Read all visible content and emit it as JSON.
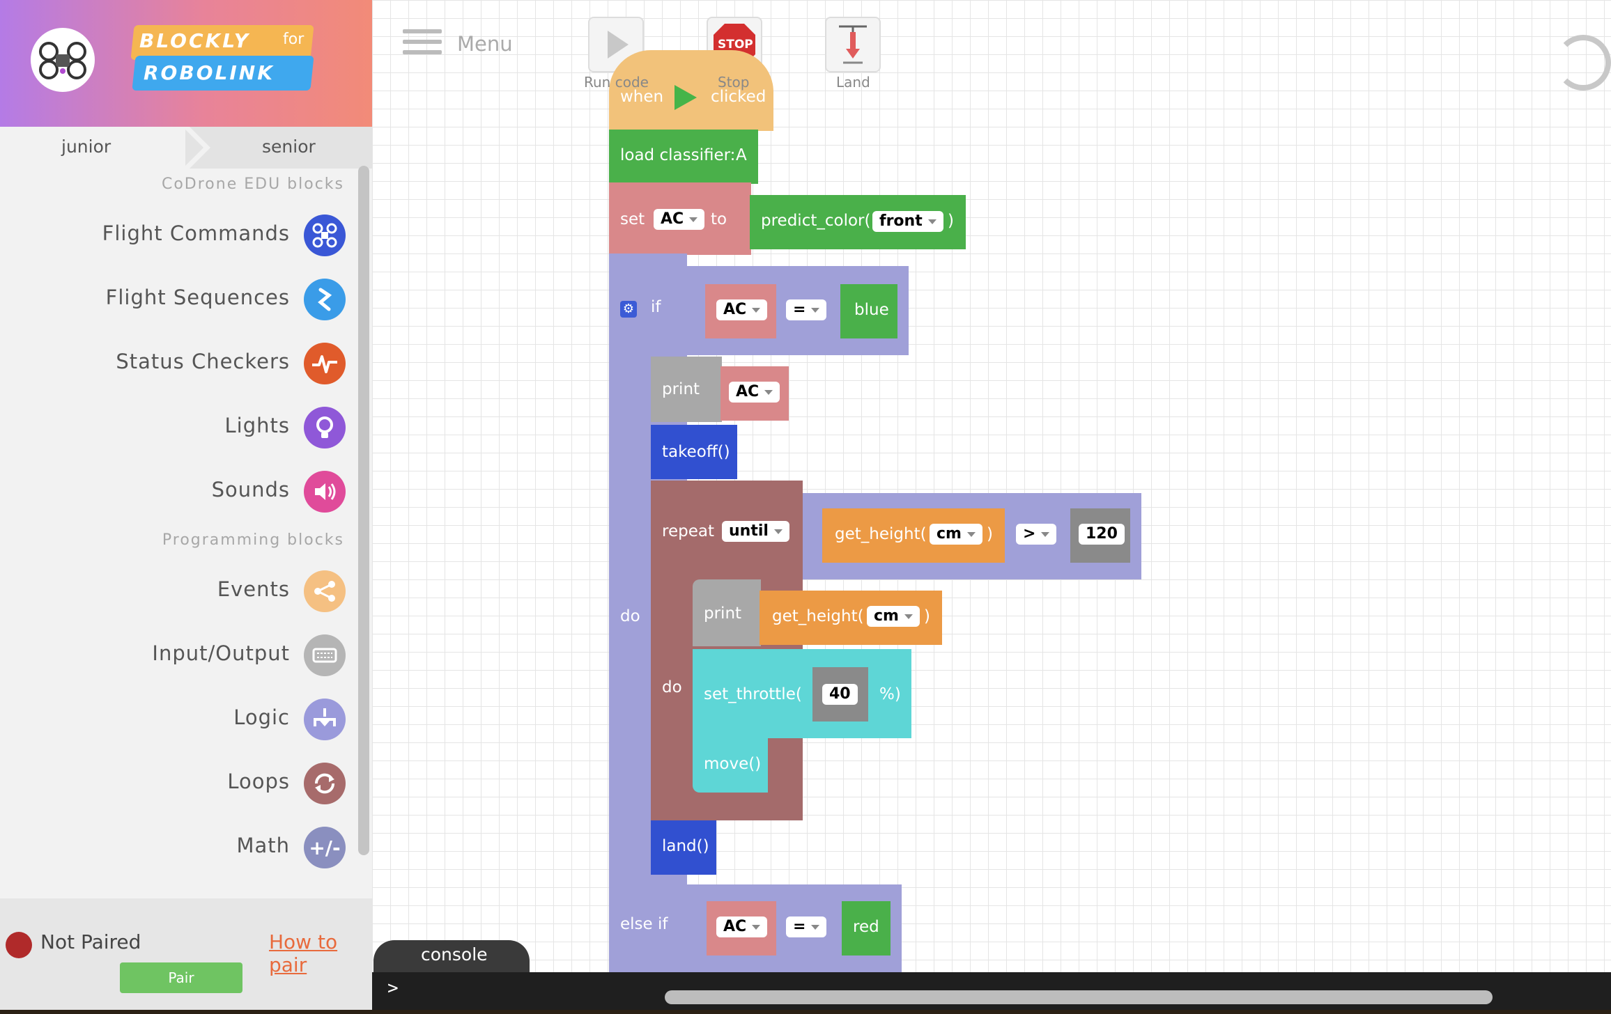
{
  "app": {
    "logo_line1": "BLOCKLY",
    "logo_for": "for",
    "logo_line2": "ROBOLINK"
  },
  "tabs": {
    "junior": "junior",
    "senior": "senior"
  },
  "sections": {
    "codrone": "CoDrone EDU blocks",
    "programming": "Programming blocks"
  },
  "categories": [
    {
      "label": "Flight Commands",
      "icon": "drone-icon",
      "color": "#3a57d6"
    },
    {
      "label": "Flight Sequences",
      "icon": "sequence-icon",
      "color": "#3a9ce8"
    },
    {
      "label": "Status Checkers",
      "icon": "pulse-icon",
      "color": "#e05b2b"
    },
    {
      "label": "Lights",
      "icon": "lightbulb-icon",
      "color": "#8f58d8"
    },
    {
      "label": "Sounds",
      "icon": "speaker-icon",
      "color": "#e04b9a"
    },
    {
      "label": "Events",
      "icon": "share-icon",
      "color": "#f5c082"
    },
    {
      "label": "Input/Output",
      "icon": "keyboard-icon",
      "color": "#b5b5b5"
    },
    {
      "label": "Logic",
      "icon": "logic-icon",
      "color": "#9a9adb"
    },
    {
      "label": "Loops",
      "icon": "loop-icon",
      "color": "#a76b6b"
    },
    {
      "label": "Math",
      "icon": "math-icon",
      "color": "#8a8fbf"
    }
  ],
  "footer": {
    "status": "Not Paired",
    "how_to_pair": "How to pair",
    "pair_button": "Pair"
  },
  "toolbar": {
    "menu_label": "Menu",
    "run_label": "Run code",
    "stop_label": "Stop",
    "stop_sign_text": "STOP",
    "land_label": "Land"
  },
  "blocks": {
    "when": "when",
    "clicked": "clicked",
    "load_classifier": "load classifier:",
    "classifier_value": "A",
    "set": "set",
    "set_var": "AC",
    "to": "to",
    "predict_color": "predict_color(",
    "predict_arg": "front",
    "close_paren": ")",
    "if": "if",
    "if_var": "AC",
    "eq_op": "=",
    "if_value": "blue",
    "do": "do",
    "print1": "print",
    "print1_var": "AC",
    "takeoff": "takeoff()",
    "repeat": "repeat",
    "repeat_mode": "until",
    "get_height": "get_height(",
    "height_unit": "cm",
    "gt_op": ">",
    "height_threshold": "120",
    "inner_do": "do",
    "print2": "print",
    "get_height2": "get_height(",
    "height_unit2": "cm",
    "set_throttle": "set_throttle(",
    "throttle_value": "40",
    "throttle_suffix": "%)",
    "move": "move()",
    "land": "land()",
    "else_if": "else if",
    "elif_var": "AC",
    "elif_op": "=",
    "elif_value": "red"
  },
  "console": {
    "tab_label": "console",
    "prompt": ">"
  }
}
